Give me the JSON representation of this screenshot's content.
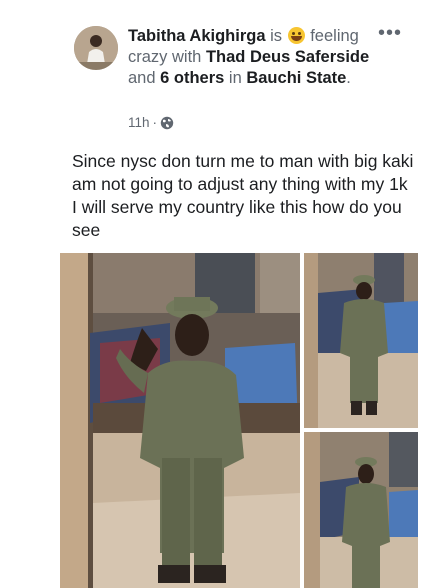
{
  "post": {
    "author": "Tabitha Akighirga",
    "activity_prefix": "is",
    "feeling_emoji": "crazy-face-emoji",
    "feeling_text": "feeling crazy with",
    "tagged_person": "Thad Deus Saferside",
    "and_text": "and",
    "others_text": "6 others",
    "in_text": "in",
    "location": "Bauchi State",
    "time": "11h",
    "privacy_icon": "globe-icon",
    "more_icon": "•••",
    "body": "Since nysc don turn me to man with big kaki am not going to adjust any thing with my 1k I will serve my country like this how do you see"
  },
  "colors": {
    "text": "#1c1e21",
    "muted": "#606770",
    "uniform": "#6b7156"
  }
}
